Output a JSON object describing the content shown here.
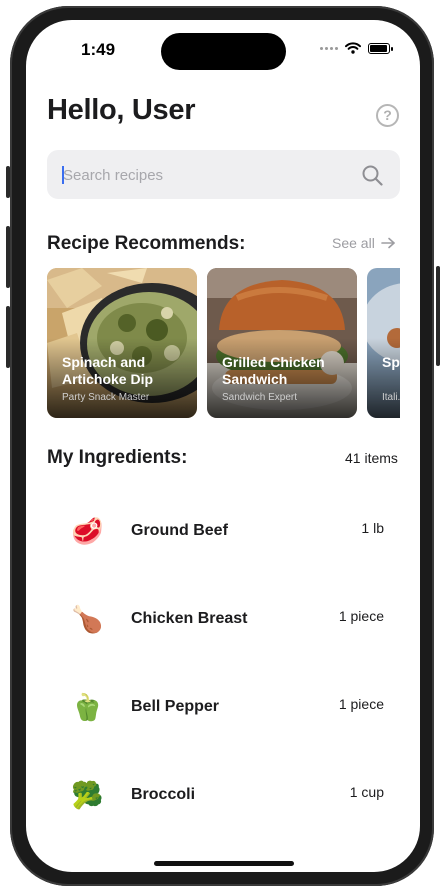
{
  "status_bar": {
    "time": "1:49"
  },
  "header": {
    "greeting": "Hello, User",
    "help_icon": "question-circle-icon",
    "help_glyph": "?"
  },
  "search": {
    "placeholder": "Search recipes",
    "icon": "magnifier-icon"
  },
  "recommendations": {
    "title": "Recipe Recommends:",
    "see_all": "See all",
    "cards": [
      {
        "title": "Spinach and Artichoke Dip",
        "subtitle": "Party Snack Master"
      },
      {
        "title": "Grilled Chicken Sandwich",
        "subtitle": "Sandwich Expert"
      },
      {
        "title": "Spicy Me...",
        "subtitle": "Itali..."
      }
    ]
  },
  "ingredients": {
    "title": "My Ingredients:",
    "count": "41 items",
    "items": [
      {
        "emoji": "🥩",
        "name": "Ground Beef",
        "qty": "1 lb"
      },
      {
        "emoji": "🍗",
        "name": "Chicken Breast",
        "qty": "1 piece"
      },
      {
        "emoji": "🫑",
        "name": "Bell Pepper",
        "qty": "1 piece"
      },
      {
        "emoji": "🥦",
        "name": "Broccoli",
        "qty": "1 cup"
      }
    ]
  }
}
